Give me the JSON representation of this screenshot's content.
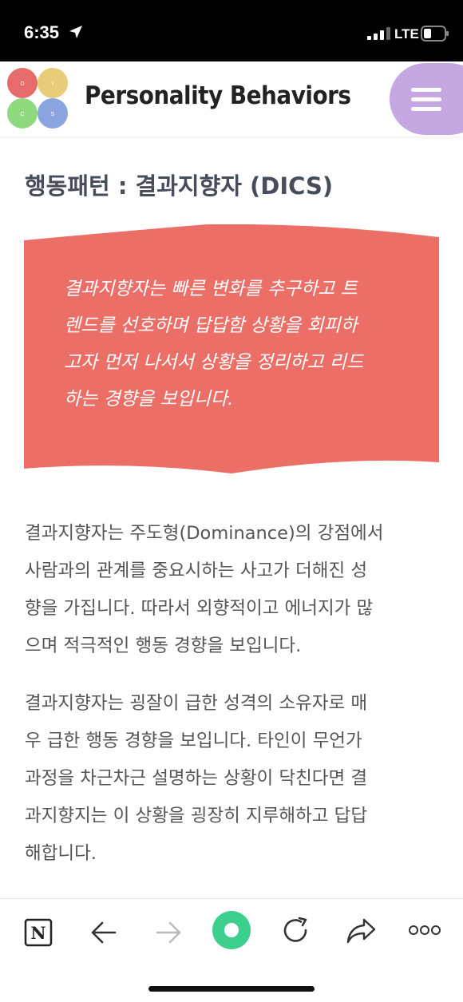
{
  "status": {
    "time": "6:35",
    "network": "LTE"
  },
  "header": {
    "site_title": "Personality Behaviors",
    "logo_letters": [
      "D",
      "I",
      "C",
      "S"
    ],
    "logo_colors": [
      "#e86b6b",
      "#e8cd79",
      "#8fd97e",
      "#8aa4e0"
    ],
    "menu_color": "#c5a8e2"
  },
  "article": {
    "title": "행동패턴 : 결과지향자 (DICS)",
    "quote_color": "#ec6f67",
    "quote_lines": [
      "결과지향자는 빠른 변화를 추구하고 트",
      "렌드를 선호하며 답답함 상황을 회피하",
      "고자 먼저 나서서 상황을 정리하고 리드",
      "하는 경향을 보입니다."
    ],
    "para1_lines": [
      "결과지향자는 주도형(Dominance)의 강점에서",
      "사람과의 관계를 중요시하는 사고가 더해진 성",
      "향을 가집니다. 따라서 외향적이고 에너지가 많",
      "으며 적극적인 행동 경향을 보입니다."
    ],
    "para2_lines": [
      "결과지향자는 굉잘이 급한 성격의 소유자로 매",
      "우 급한 행동 경향을 보입니다. 타인이 무언가",
      "과정을 차근차근 설명하는 상황이 닥친다면 결",
      "과지향지는 이 상황을 굉장히 지루해하고 답답",
      "해합니다."
    ]
  },
  "toolbar": {
    "icons": [
      "notion-icon",
      "back-arrow-icon",
      "forward-arrow-icon",
      "home-circle-icon",
      "reload-icon",
      "share-icon",
      "more-icon"
    ],
    "notion_letter": "N",
    "accent": "#3ccf8e"
  }
}
